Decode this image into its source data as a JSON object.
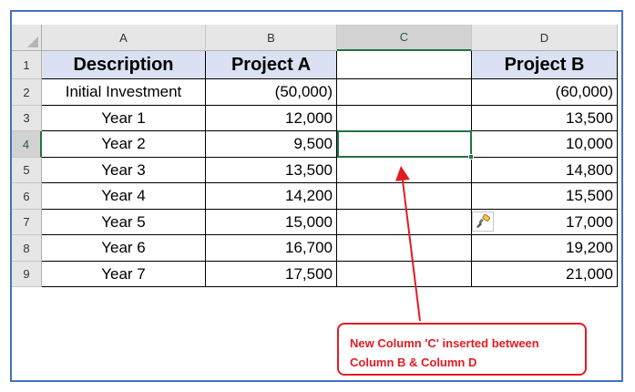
{
  "columns": [
    "A",
    "B",
    "C",
    "D"
  ],
  "selected_column": "C",
  "selected_row": "4",
  "header_row": {
    "row": "1",
    "cells": [
      "Description",
      "Project A",
      "",
      "Project B"
    ]
  },
  "rows": [
    {
      "row": "2",
      "cells": [
        "Initial Investment",
        "(50,000)",
        "",
        "(60,000)"
      ]
    },
    {
      "row": "3",
      "cells": [
        "Year 1",
        "12,000",
        "",
        "13,500"
      ]
    },
    {
      "row": "4",
      "cells": [
        "Year 2",
        "9,500",
        "",
        "10,000"
      ]
    },
    {
      "row": "5",
      "cells": [
        "Year 3",
        "13,500",
        "",
        "14,800"
      ]
    },
    {
      "row": "6",
      "cells": [
        "Year 4",
        "14,200",
        "",
        "15,500"
      ]
    },
    {
      "row": "7",
      "cells": [
        "Year 5",
        "15,000",
        "",
        "17,000"
      ]
    },
    {
      "row": "8",
      "cells": [
        "Year 6",
        "16,700",
        "",
        "19,200"
      ]
    },
    {
      "row": "9",
      "cells": [
        "Year 7",
        "17,500",
        "",
        "21,000"
      ]
    }
  ],
  "callout": {
    "line1": "New Column 'C' inserted between",
    "line2": "Column B & Column D"
  },
  "icons": {
    "corner": "select-all-triangle-icon",
    "paste_format": "format-painter-brush-icon"
  },
  "colors": {
    "header_fill": "#d9e1f2",
    "selection": "#217346",
    "annotation": "#e31b23",
    "frame": "#4472c4"
  }
}
